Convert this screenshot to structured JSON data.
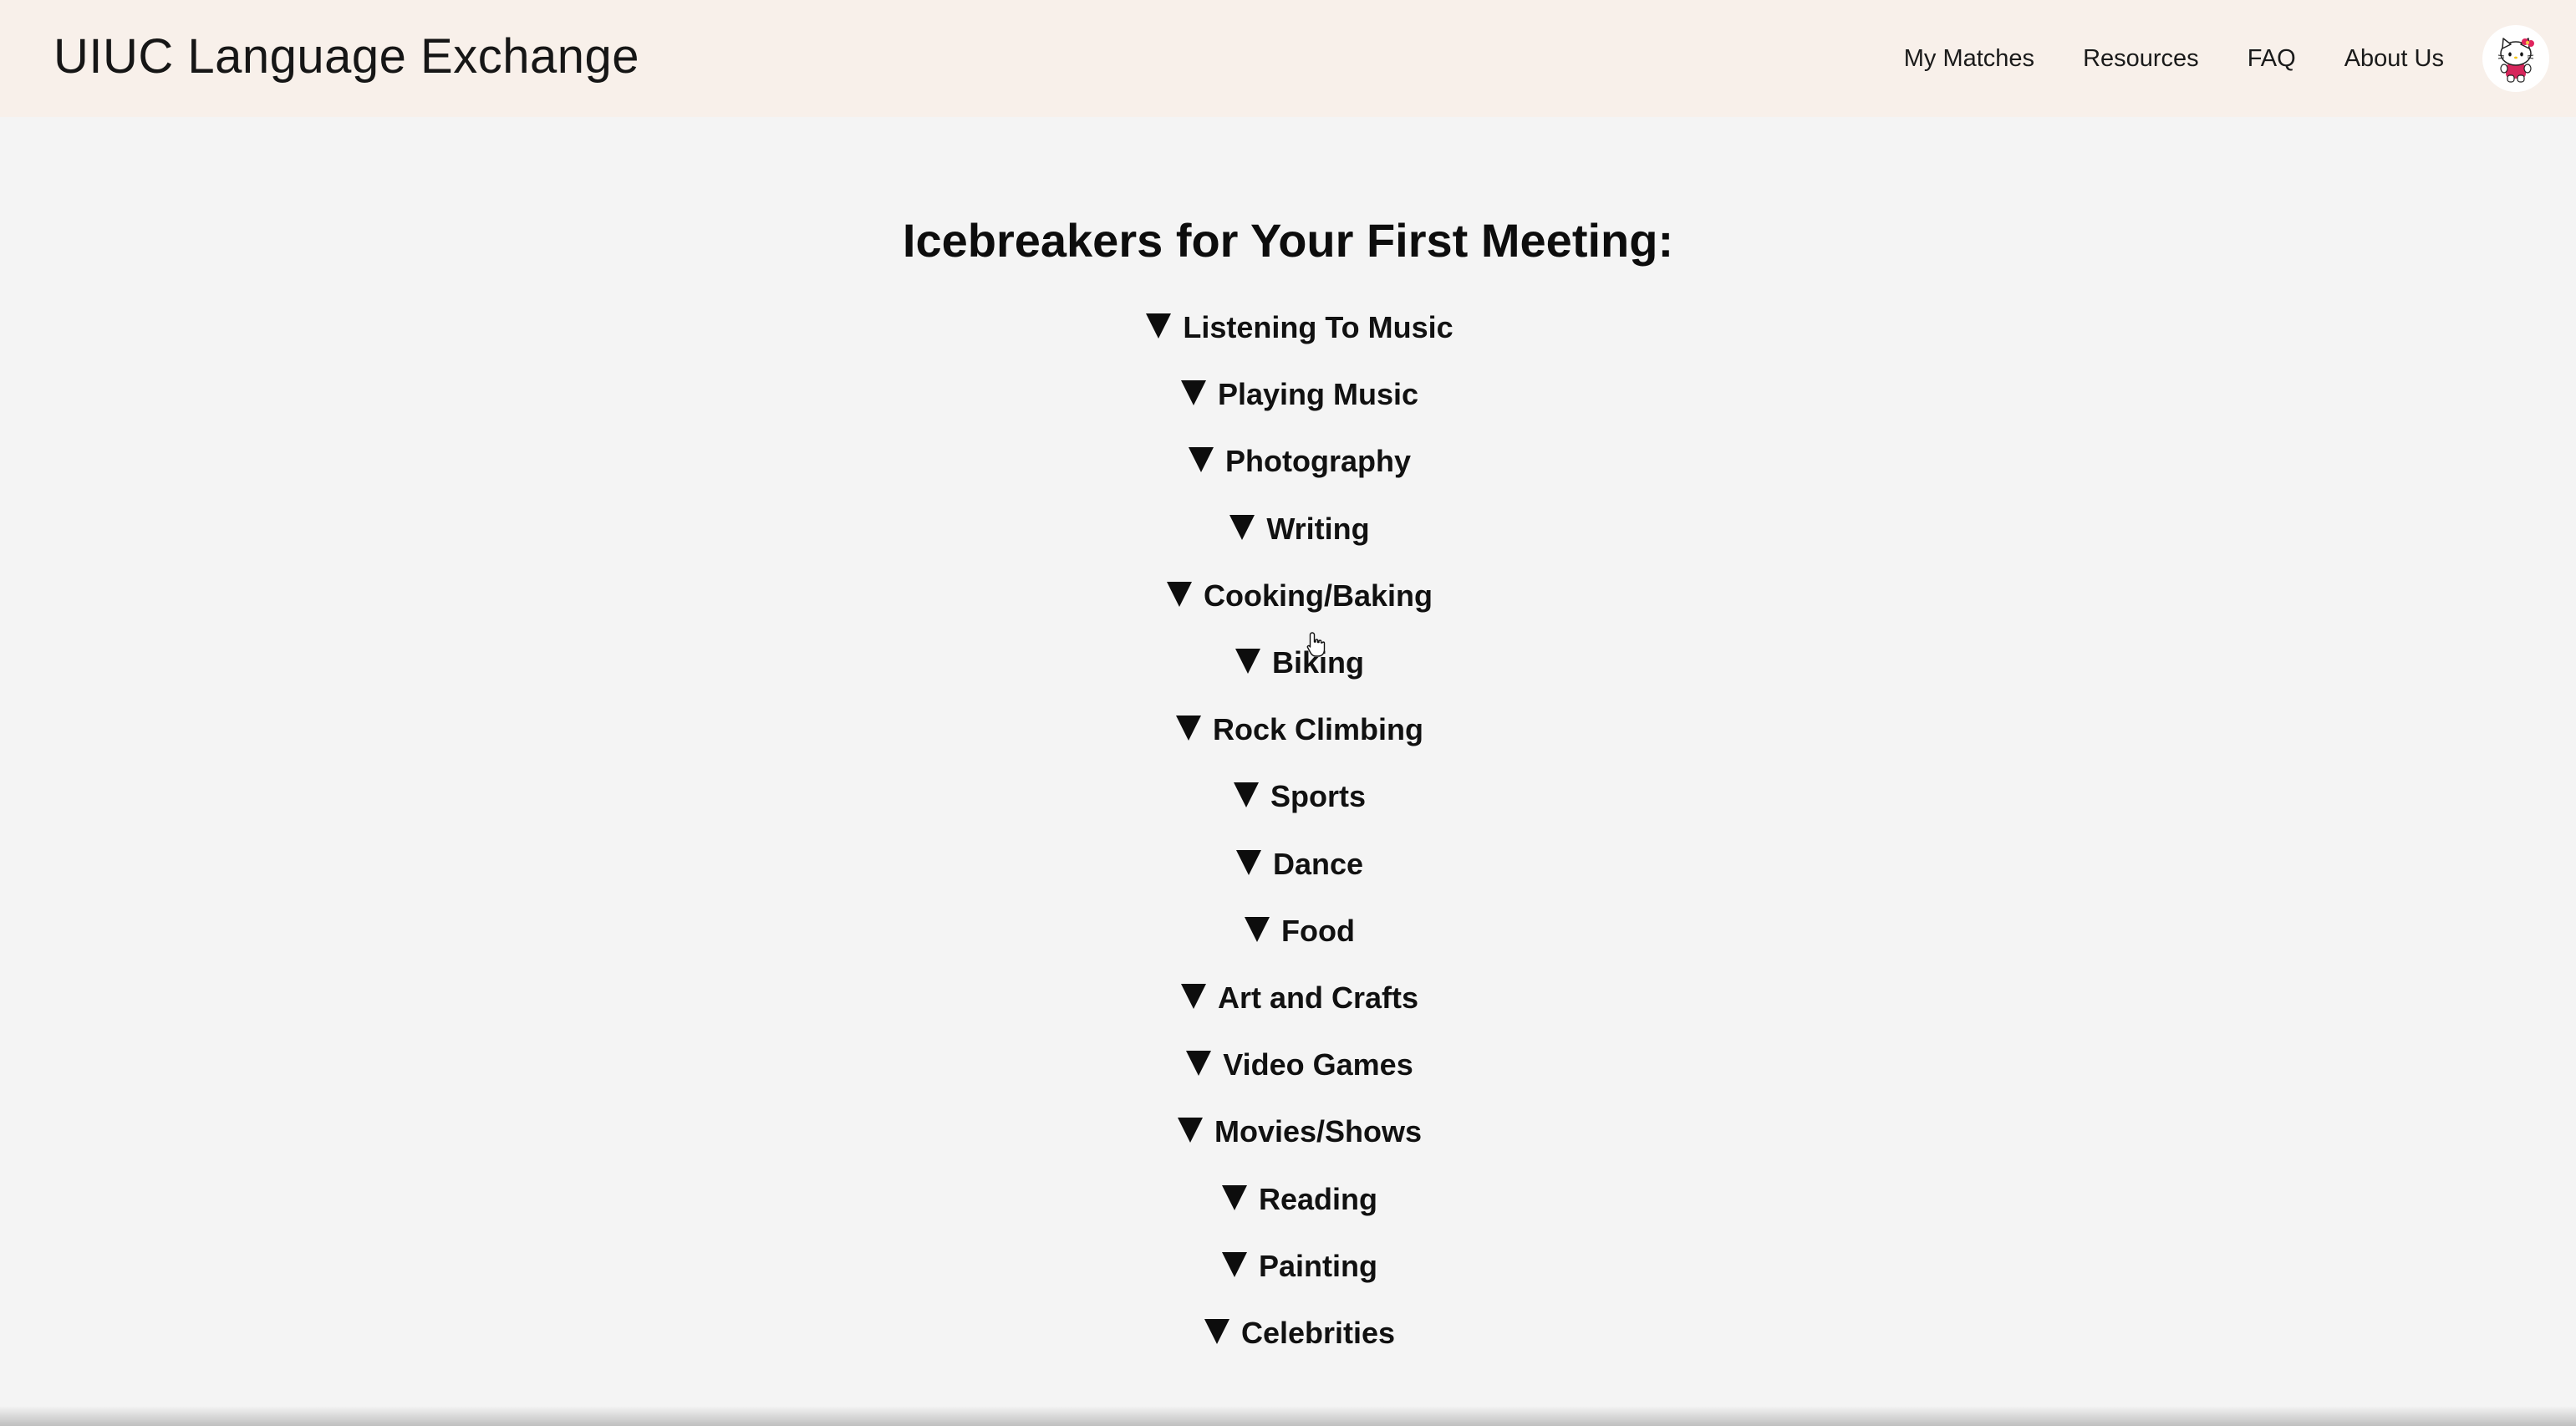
{
  "header": {
    "brand": "UIUC Language Exchange",
    "nav": [
      {
        "label": "My Matches"
      },
      {
        "label": "Resources"
      },
      {
        "label": "FAQ"
      },
      {
        "label": "About Us"
      }
    ],
    "avatar_icon": "hello-kitty-avatar-icon"
  },
  "main": {
    "title": "Icebreakers for Your First Meeting:",
    "topics": [
      {
        "label": "Listening To Music"
      },
      {
        "label": "Playing Music"
      },
      {
        "label": "Photography"
      },
      {
        "label": "Writing"
      },
      {
        "label": "Cooking/Baking"
      },
      {
        "label": "Biking"
      },
      {
        "label": "Rock Climbing"
      },
      {
        "label": "Sports"
      },
      {
        "label": "Dance"
      },
      {
        "label": "Food"
      },
      {
        "label": "Art and Crafts"
      },
      {
        "label": "Video Games"
      },
      {
        "label": "Movies/Shows"
      },
      {
        "label": "Reading"
      },
      {
        "label": "Painting"
      },
      {
        "label": "Celebrities"
      }
    ],
    "expand_icon": "triangle-down-icon"
  },
  "colors": {
    "header_bg": "#f8f0ea",
    "page_bg": "#f4f4f4",
    "text": "#111111"
  }
}
